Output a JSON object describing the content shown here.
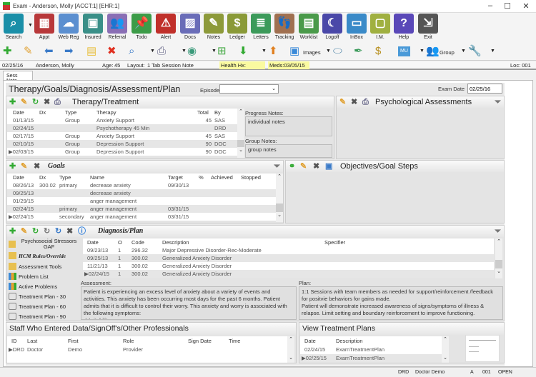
{
  "window": {
    "title": "Exam - Anderson, Molly [ACCT:1] [EHR:1]"
  },
  "toolbar_main": [
    {
      "label": "Search",
      "icon": "search-icon",
      "color": "#1a8fa8"
    },
    {
      "label": "Appt",
      "icon": "calendar-icon",
      "color": "#b8383a"
    },
    {
      "label": "Web Reg",
      "icon": "cloud-icon",
      "color": "#5b8fd0"
    },
    {
      "label": "Insured",
      "icon": "id-card-icon",
      "color": "#3a8f88"
    },
    {
      "label": "Referral",
      "icon": "people-icon",
      "color": "#8a6fb5"
    },
    {
      "label": "Todo",
      "icon": "pushpin-icon",
      "color": "#3c9c48"
    },
    {
      "label": "Alert",
      "icon": "alert-icon",
      "color": "#c0302a"
    },
    {
      "label": "Docs",
      "icon": "image-icon",
      "color": "#6a6db8"
    },
    {
      "label": "Notes",
      "icon": "note-edit-icon",
      "color": "#8d9a3a"
    },
    {
      "label": "Ledger",
      "icon": "dollar-icon",
      "color": "#8a9a38"
    },
    {
      "label": "Letters",
      "icon": "letter-icon",
      "color": "#3c9a5a"
    },
    {
      "label": "Tracking",
      "icon": "footprints-icon",
      "color": "#a07050"
    },
    {
      "label": "Worklist",
      "icon": "clipboard-icon",
      "color": "#4a9a4a"
    },
    {
      "label": "Logoff",
      "icon": "moon-icon",
      "color": "#4a48a8"
    },
    {
      "label": "InBox",
      "icon": "inbox-icon",
      "color": "#3a8ac8"
    },
    {
      "label": "I.M.",
      "icon": "chat-icon",
      "color": "#a0b040"
    },
    {
      "label": "Help",
      "icon": "help-icon",
      "color": "#5a48b8"
    },
    {
      "label": "Exit",
      "icon": "exit-icon",
      "color": "#555555"
    }
  ],
  "toolbar_secondary": {
    "images_label": "Images",
    "group_label": "Group",
    "mu_label": "MU"
  },
  "info": {
    "date": "02/25/16",
    "patient": "Anderson, Molly",
    "age_label": "Age:",
    "age": "45",
    "layout_label": "Layout:",
    "layout": "1 Tab Session Note",
    "health_hx": "Health Hx:",
    "meds": "Meds:03/05/15",
    "loc": "Loc: 001"
  },
  "tab": "Sess Note",
  "header": {
    "title": "Therapy/Goals/Diagnosis/Assessment/Plan",
    "episode_label": "Episode",
    "episode_value": "",
    "exam_date_label": "Exam Date",
    "exam_date": "02/25/16"
  },
  "therapy": {
    "title": "Therapy/Treatment",
    "columns": [
      "Date",
      "Dx",
      "Type",
      "Therapy",
      "Total",
      "By"
    ],
    "rows": [
      [
        "01/13/15",
        "",
        "Group",
        "Anxiety Support",
        "45",
        "SAS"
      ],
      [
        "02/24/15",
        "",
        "",
        "Psychotherapy 45 Min",
        "",
        "DRD"
      ],
      [
        "02/17/15",
        "",
        "Group",
        "Anxiety Support",
        "45",
        "SAS"
      ],
      [
        "02/10/15",
        "",
        "Group",
        "Depression Support",
        "90",
        "DOC"
      ],
      [
        "02/03/15",
        "",
        "Group",
        "Depression Support",
        "90",
        "DOC"
      ]
    ],
    "progress_notes_label": "Progress Notes:",
    "progress_notes": "individual notes",
    "group_notes_label": "Group Notes:",
    "group_notes": "group notes"
  },
  "psych": {
    "title": "Psychological Assessments"
  },
  "goals": {
    "title": "Goals",
    "columns": [
      "Date",
      "Dx",
      "Type",
      "Name",
      "Target",
      "%",
      "Achieved",
      "Stopped"
    ],
    "rows": [
      [
        "08/26/13",
        "300.02",
        "primary",
        "decrease anxiety",
        "09/30/13",
        "",
        "",
        ""
      ],
      [
        "09/25/13",
        "",
        "",
        "decrease anxiety",
        "",
        "",
        "",
        ""
      ],
      [
        "01/29/15",
        "",
        "",
        "anger management",
        "",
        "",
        "",
        ""
      ],
      [
        "02/24/15",
        "",
        "primary",
        "anger management",
        "03/31/15",
        "",
        "",
        ""
      ],
      [
        "02/24/15",
        "",
        "secondary",
        "anger management",
        "03/31/15",
        "",
        "",
        ""
      ]
    ]
  },
  "objectives": {
    "title": "Objectives/Goal Steps"
  },
  "diagnosis": {
    "title": "Diagnosis/Plan",
    "side_items": [
      "Psychosocial Stressors GAF",
      "HCM Rules/Override",
      "Assessment Tools",
      "Problem List",
      "Active Problems",
      "Treatment Plan - 30",
      "Treatment Plan - 60",
      "Treatment Plan - 90"
    ],
    "columns": [
      "Date",
      "O",
      "Code",
      "Description",
      "Specifier"
    ],
    "rows": [
      [
        "09/23/13",
        "1",
        "296.32",
        "Major Depressive Disorder-Rec-Moderate",
        ""
      ],
      [
        "09/25/13",
        "1",
        "300.02",
        "Generalized Anxiety Disorder",
        ""
      ],
      [
        "11/21/13",
        "1",
        "300.02",
        "Generalized Anxiety Disorder",
        ""
      ],
      [
        "02/24/15",
        "1",
        "300.02",
        "Generalized Anxiety Disorder",
        ""
      ]
    ],
    "assessment_label": "Assessment:",
    "assessment": "Patient is experiencing an excess level of anxiety about a variety of events and activities. This anxiety has been occurring most days for the past 6 months. Patient admits that it is difficult to control their worry. This anxiety and worry is associated with the following symptoms:\n * Irritability",
    "plan_label": "Plan:",
    "plan": "1:1 Sessions with team members as needed for support/reinforcement /feedback for positvie behaviors for gains made.\nPatient will demonstrate increased awareness of signs/symptoms of illness & relapse. Limit setting and boundary reinforcement to improve functioning."
  },
  "staff": {
    "title": "Staff Who Entered Data/SignOff's/Other Professionals",
    "columns": [
      "ID",
      "Last",
      "First",
      "Role",
      "Sign Date",
      "Time"
    ],
    "rows": [
      [
        "DRD",
        "Doctor",
        "Demo",
        "Provider",
        "",
        ""
      ]
    ]
  },
  "plans": {
    "title": "View Treatment Plans",
    "columns": [
      "Date",
      "Description"
    ],
    "rows": [
      [
        "02/24/15",
        "ExamTreatmentPlan"
      ],
      [
        "02/25/15",
        "ExamTreatmentPlan"
      ]
    ]
  },
  "status": {
    "user_id": "DRD",
    "user_name": "Doctor Demo",
    "mode": "A",
    "loc": "001",
    "state": "OPEN"
  }
}
